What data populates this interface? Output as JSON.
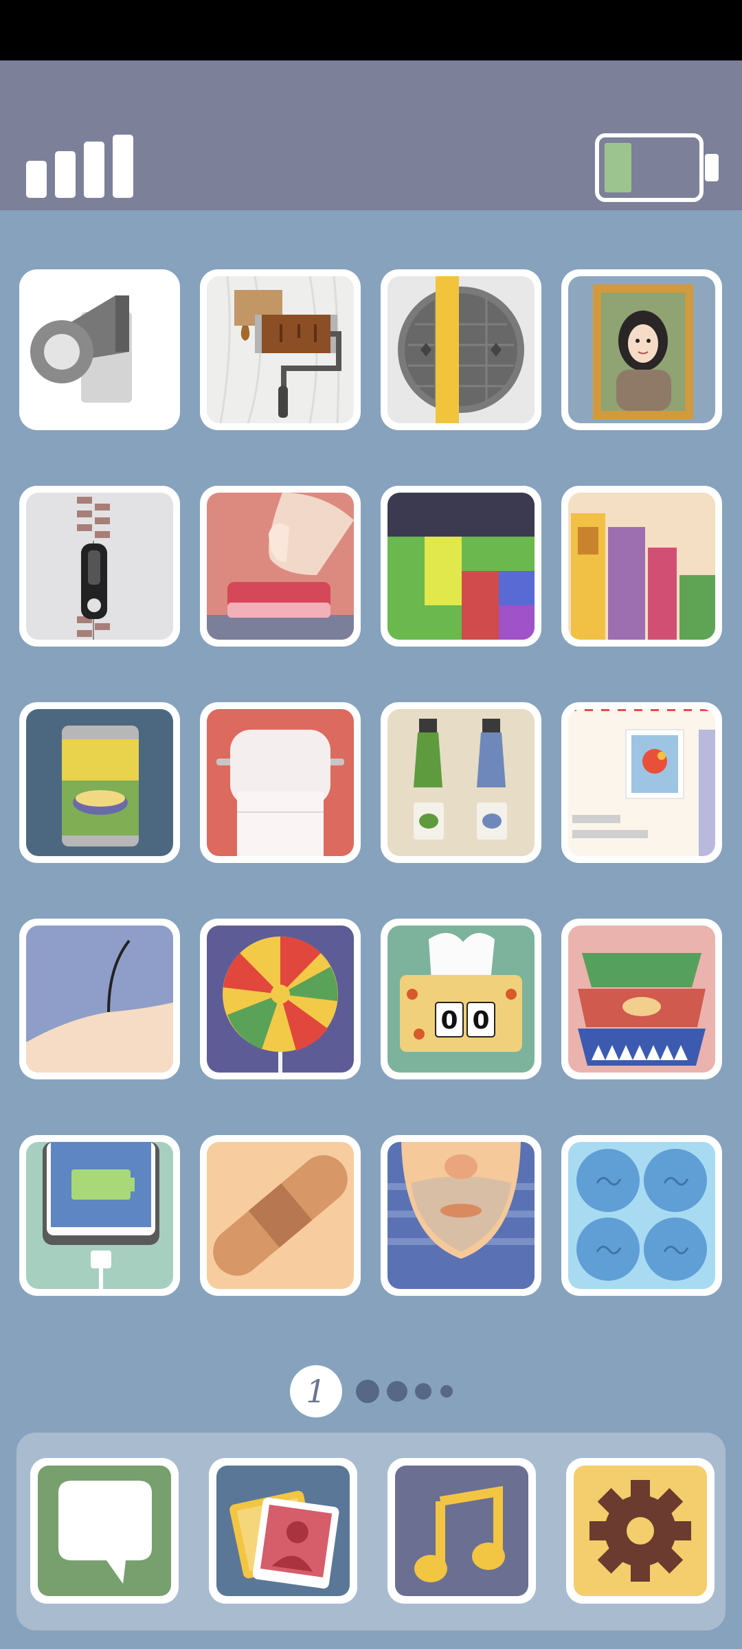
{
  "status_bar": {
    "signal_bars": 4,
    "battery_level": 0.3,
    "battery_color": "#9cc48e"
  },
  "colors": {
    "background": "#87a2bd",
    "status_bar": "#7c8099",
    "dock": "#a9bbcf",
    "tile_frame": "#ffffff"
  },
  "apps": [
    {
      "icon": "security-camera-icon"
    },
    {
      "icon": "paint-roller-icon"
    },
    {
      "icon": "manhole-cover-icon"
    },
    {
      "icon": "portrait-painting-icon"
    },
    {
      "icon": "zipper-icon"
    },
    {
      "icon": "red-button-icon"
    },
    {
      "icon": "block-puzzle-icon"
    },
    {
      "icon": "bookshelf-icon"
    },
    {
      "icon": "soup-can-icon"
    },
    {
      "icon": "toilet-paper-icon"
    },
    {
      "icon": "paint-tubes-icon"
    },
    {
      "icon": "envelope-stamp-icon"
    },
    {
      "icon": "skin-hair-icon"
    },
    {
      "icon": "lollipop-icon"
    },
    {
      "icon": "tissue-box-icon"
    },
    {
      "icon": "stacked-bowls-icon"
    },
    {
      "icon": "phone-charging-icon"
    },
    {
      "icon": "bandage-icon"
    },
    {
      "icon": "stubble-chin-icon"
    },
    {
      "icon": "bubble-wrap-icon"
    }
  ],
  "pager": {
    "current_page": "1",
    "total_pages": 5
  },
  "dock": [
    {
      "icon": "messages-icon",
      "color": "#77a06e"
    },
    {
      "icon": "photos-icon",
      "color": "#5b7797"
    },
    {
      "icon": "music-icon",
      "color": "#6b6f92"
    },
    {
      "icon": "settings-gear-icon",
      "color": "#f4cd6c"
    }
  ]
}
